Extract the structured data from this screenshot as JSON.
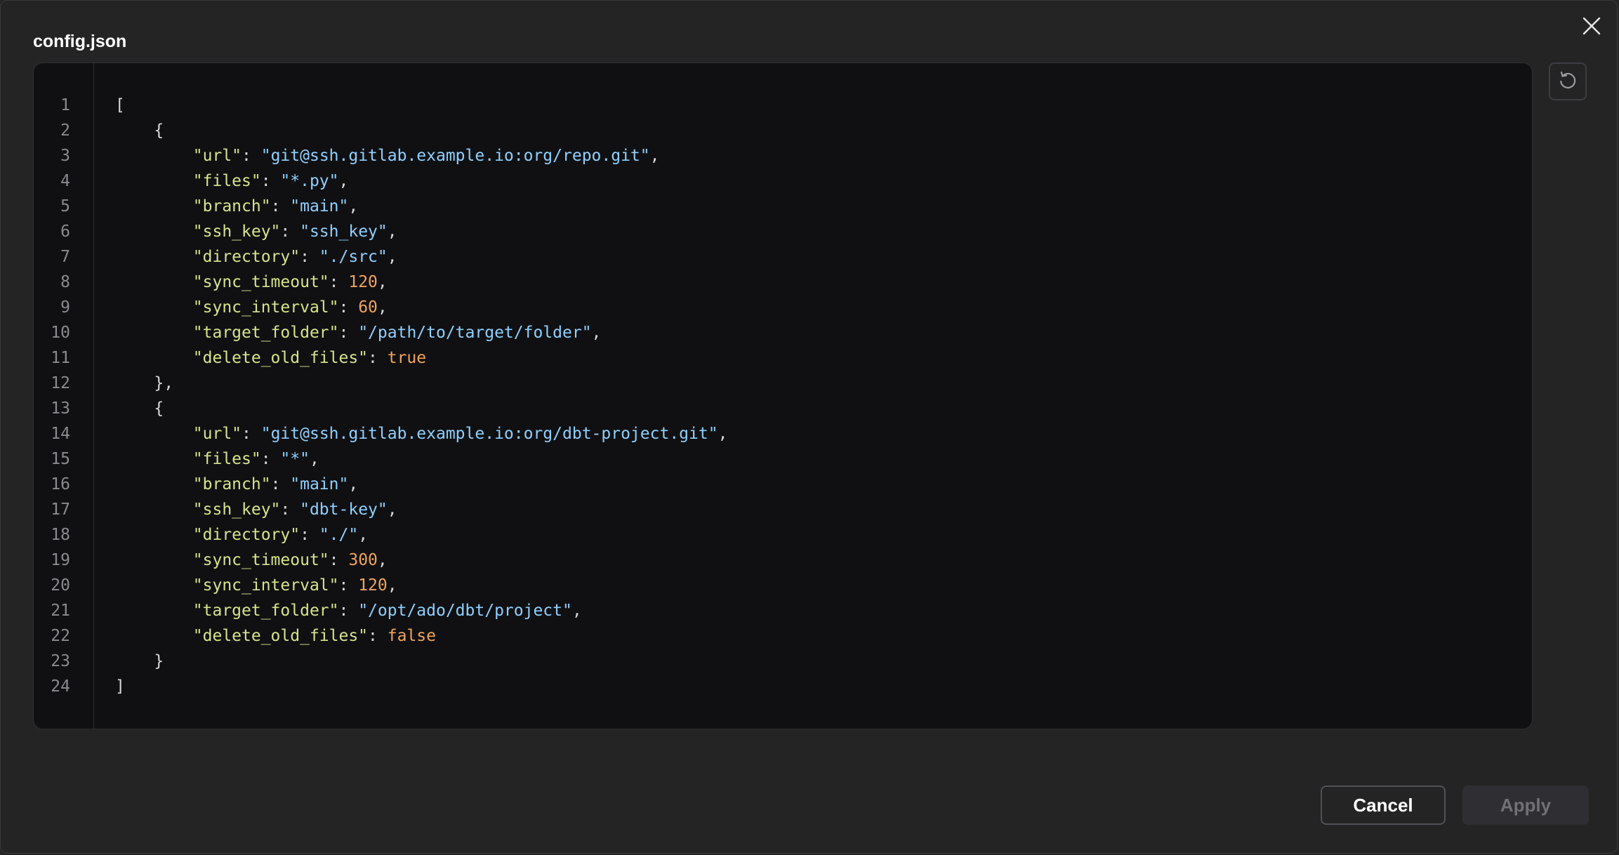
{
  "dialog": {
    "title": "config.json",
    "close_icon": "close-icon",
    "reset_icon": "reset-icon"
  },
  "editor": {
    "language": "json",
    "line_numbers": [
      "1",
      "2",
      "3",
      "4",
      "5",
      "6",
      "7",
      "8",
      "9",
      "10",
      "11",
      "12",
      "13",
      "14",
      "15",
      "16",
      "17",
      "18",
      "19",
      "20",
      "21",
      "22",
      "23",
      "24"
    ],
    "lines": [
      [
        {
          "t": "[",
          "c": "p"
        }
      ],
      [
        {
          "t": "    {",
          "c": "p"
        }
      ],
      [
        {
          "t": "        ",
          "c": "p"
        },
        {
          "t": "\"url\"",
          "c": "k"
        },
        {
          "t": ": ",
          "c": "p"
        },
        {
          "t": "\"git@ssh.gitlab.example.io:org/repo.git\"",
          "c": "s"
        },
        {
          "t": ",",
          "c": "p"
        }
      ],
      [
        {
          "t": "        ",
          "c": "p"
        },
        {
          "t": "\"files\"",
          "c": "k"
        },
        {
          "t": ": ",
          "c": "p"
        },
        {
          "t": "\"*.py\"",
          "c": "s"
        },
        {
          "t": ",",
          "c": "p"
        }
      ],
      [
        {
          "t": "        ",
          "c": "p"
        },
        {
          "t": "\"branch\"",
          "c": "k"
        },
        {
          "t": ": ",
          "c": "p"
        },
        {
          "t": "\"main\"",
          "c": "s"
        },
        {
          "t": ",",
          "c": "p"
        }
      ],
      [
        {
          "t": "        ",
          "c": "p"
        },
        {
          "t": "\"ssh_key\"",
          "c": "k"
        },
        {
          "t": ": ",
          "c": "p"
        },
        {
          "t": "\"ssh_key\"",
          "c": "s"
        },
        {
          "t": ",",
          "c": "p"
        }
      ],
      [
        {
          "t": "        ",
          "c": "p"
        },
        {
          "t": "\"directory\"",
          "c": "k"
        },
        {
          "t": ": ",
          "c": "p"
        },
        {
          "t": "\"./src\"",
          "c": "s"
        },
        {
          "t": ",",
          "c": "p"
        }
      ],
      [
        {
          "t": "        ",
          "c": "p"
        },
        {
          "t": "\"sync_timeout\"",
          "c": "k"
        },
        {
          "t": ": ",
          "c": "p"
        },
        {
          "t": "120",
          "c": "n"
        },
        {
          "t": ",",
          "c": "p"
        }
      ],
      [
        {
          "t": "        ",
          "c": "p"
        },
        {
          "t": "\"sync_interval\"",
          "c": "k"
        },
        {
          "t": ": ",
          "c": "p"
        },
        {
          "t": "60",
          "c": "n"
        },
        {
          "t": ",",
          "c": "p"
        }
      ],
      [
        {
          "t": "        ",
          "c": "p"
        },
        {
          "t": "\"target_folder\"",
          "c": "k"
        },
        {
          "t": ": ",
          "c": "p"
        },
        {
          "t": "\"/path/to/target/folder\"",
          "c": "s"
        },
        {
          "t": ",",
          "c": "p"
        }
      ],
      [
        {
          "t": "        ",
          "c": "p"
        },
        {
          "t": "\"delete_old_files\"",
          "c": "k"
        },
        {
          "t": ": ",
          "c": "p"
        },
        {
          "t": "true",
          "c": "n"
        }
      ],
      [
        {
          "t": "    },",
          "c": "p"
        }
      ],
      [
        {
          "t": "    {",
          "c": "p"
        }
      ],
      [
        {
          "t": "        ",
          "c": "p"
        },
        {
          "t": "\"url\"",
          "c": "k"
        },
        {
          "t": ": ",
          "c": "p"
        },
        {
          "t": "\"git@ssh.gitlab.example.io:org/dbt-project.git\"",
          "c": "s"
        },
        {
          "t": ",",
          "c": "p"
        }
      ],
      [
        {
          "t": "        ",
          "c": "p"
        },
        {
          "t": "\"files\"",
          "c": "k"
        },
        {
          "t": ": ",
          "c": "p"
        },
        {
          "t": "\"*\"",
          "c": "s"
        },
        {
          "t": ",",
          "c": "p"
        }
      ],
      [
        {
          "t": "        ",
          "c": "p"
        },
        {
          "t": "\"branch\"",
          "c": "k"
        },
        {
          "t": ": ",
          "c": "p"
        },
        {
          "t": "\"main\"",
          "c": "s"
        },
        {
          "t": ",",
          "c": "p"
        }
      ],
      [
        {
          "t": "        ",
          "c": "p"
        },
        {
          "t": "\"ssh_key\"",
          "c": "k"
        },
        {
          "t": ": ",
          "c": "p"
        },
        {
          "t": "\"dbt-key\"",
          "c": "s"
        },
        {
          "t": ",",
          "c": "p"
        }
      ],
      [
        {
          "t": "        ",
          "c": "p"
        },
        {
          "t": "\"directory\"",
          "c": "k"
        },
        {
          "t": ": ",
          "c": "p"
        },
        {
          "t": "\"./\"",
          "c": "s"
        },
        {
          "t": ",",
          "c": "p"
        }
      ],
      [
        {
          "t": "        ",
          "c": "p"
        },
        {
          "t": "\"sync_timeout\"",
          "c": "k"
        },
        {
          "t": ": ",
          "c": "p"
        },
        {
          "t": "300",
          "c": "n"
        },
        {
          "t": ",",
          "c": "p"
        }
      ],
      [
        {
          "t": "        ",
          "c": "p"
        },
        {
          "t": "\"sync_interval\"",
          "c": "k"
        },
        {
          "t": ": ",
          "c": "p"
        },
        {
          "t": "120",
          "c": "n"
        },
        {
          "t": ",",
          "c": "p"
        }
      ],
      [
        {
          "t": "        ",
          "c": "p"
        },
        {
          "t": "\"target_folder\"",
          "c": "k"
        },
        {
          "t": ": ",
          "c": "p"
        },
        {
          "t": "\"/opt/ado/dbt/project\"",
          "c": "s"
        },
        {
          "t": ",",
          "c": "p"
        }
      ],
      [
        {
          "t": "        ",
          "c": "p"
        },
        {
          "t": "\"delete_old_files\"",
          "c": "k"
        },
        {
          "t": ": ",
          "c": "p"
        },
        {
          "t": "false",
          "c": "n"
        }
      ],
      [
        {
          "t": "    }",
          "c": "p"
        }
      ],
      [
        {
          "t": "]",
          "c": "p"
        }
      ]
    ]
  },
  "footer": {
    "cancel_label": "Cancel",
    "apply_label": "Apply"
  },
  "colors": {
    "key": "#d6e48a",
    "string": "#8fd0ff",
    "number": "#f0a45c",
    "background": "#242424",
    "editor_background": "#101012"
  }
}
